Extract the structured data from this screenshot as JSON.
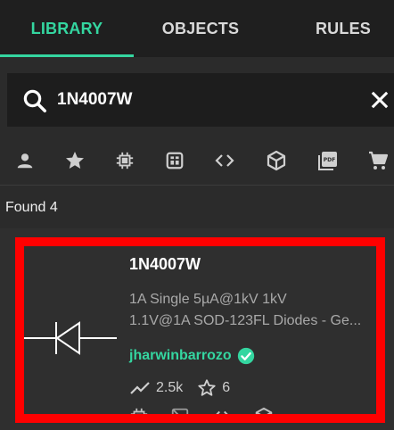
{
  "tabs": [
    {
      "label": "LIBRARY",
      "active": true
    },
    {
      "label": "OBJECTS",
      "active": false
    },
    {
      "label": "RULES",
      "active": false
    }
  ],
  "search": {
    "value": "1N4007W",
    "icon": "search-icon",
    "clear_icon": "close-icon"
  },
  "filters": [
    {
      "name": "user-icon"
    },
    {
      "name": "star-icon"
    },
    {
      "name": "chip-icon"
    },
    {
      "name": "module-icon"
    },
    {
      "name": "code-icon"
    },
    {
      "name": "cube-icon"
    },
    {
      "name": "pdf-icon"
    },
    {
      "name": "cart-icon"
    }
  ],
  "results": {
    "found_text": "Found 4"
  },
  "card": {
    "title": "1N4007W",
    "desc_line1": "1A Single 5µA@1kV 1kV",
    "desc_line2": "1.1V@1A SOD-123FL Diodes - Ge...",
    "author": "jharwinbarrozo",
    "verified_icon": "verified-badge-icon",
    "views": "2.5k",
    "stars": "6"
  },
  "colors": {
    "accent": "#34d6a0",
    "highlight": "#ff0000",
    "background": "#2b2b2b",
    "tab_bar": "#1f1f1f"
  }
}
